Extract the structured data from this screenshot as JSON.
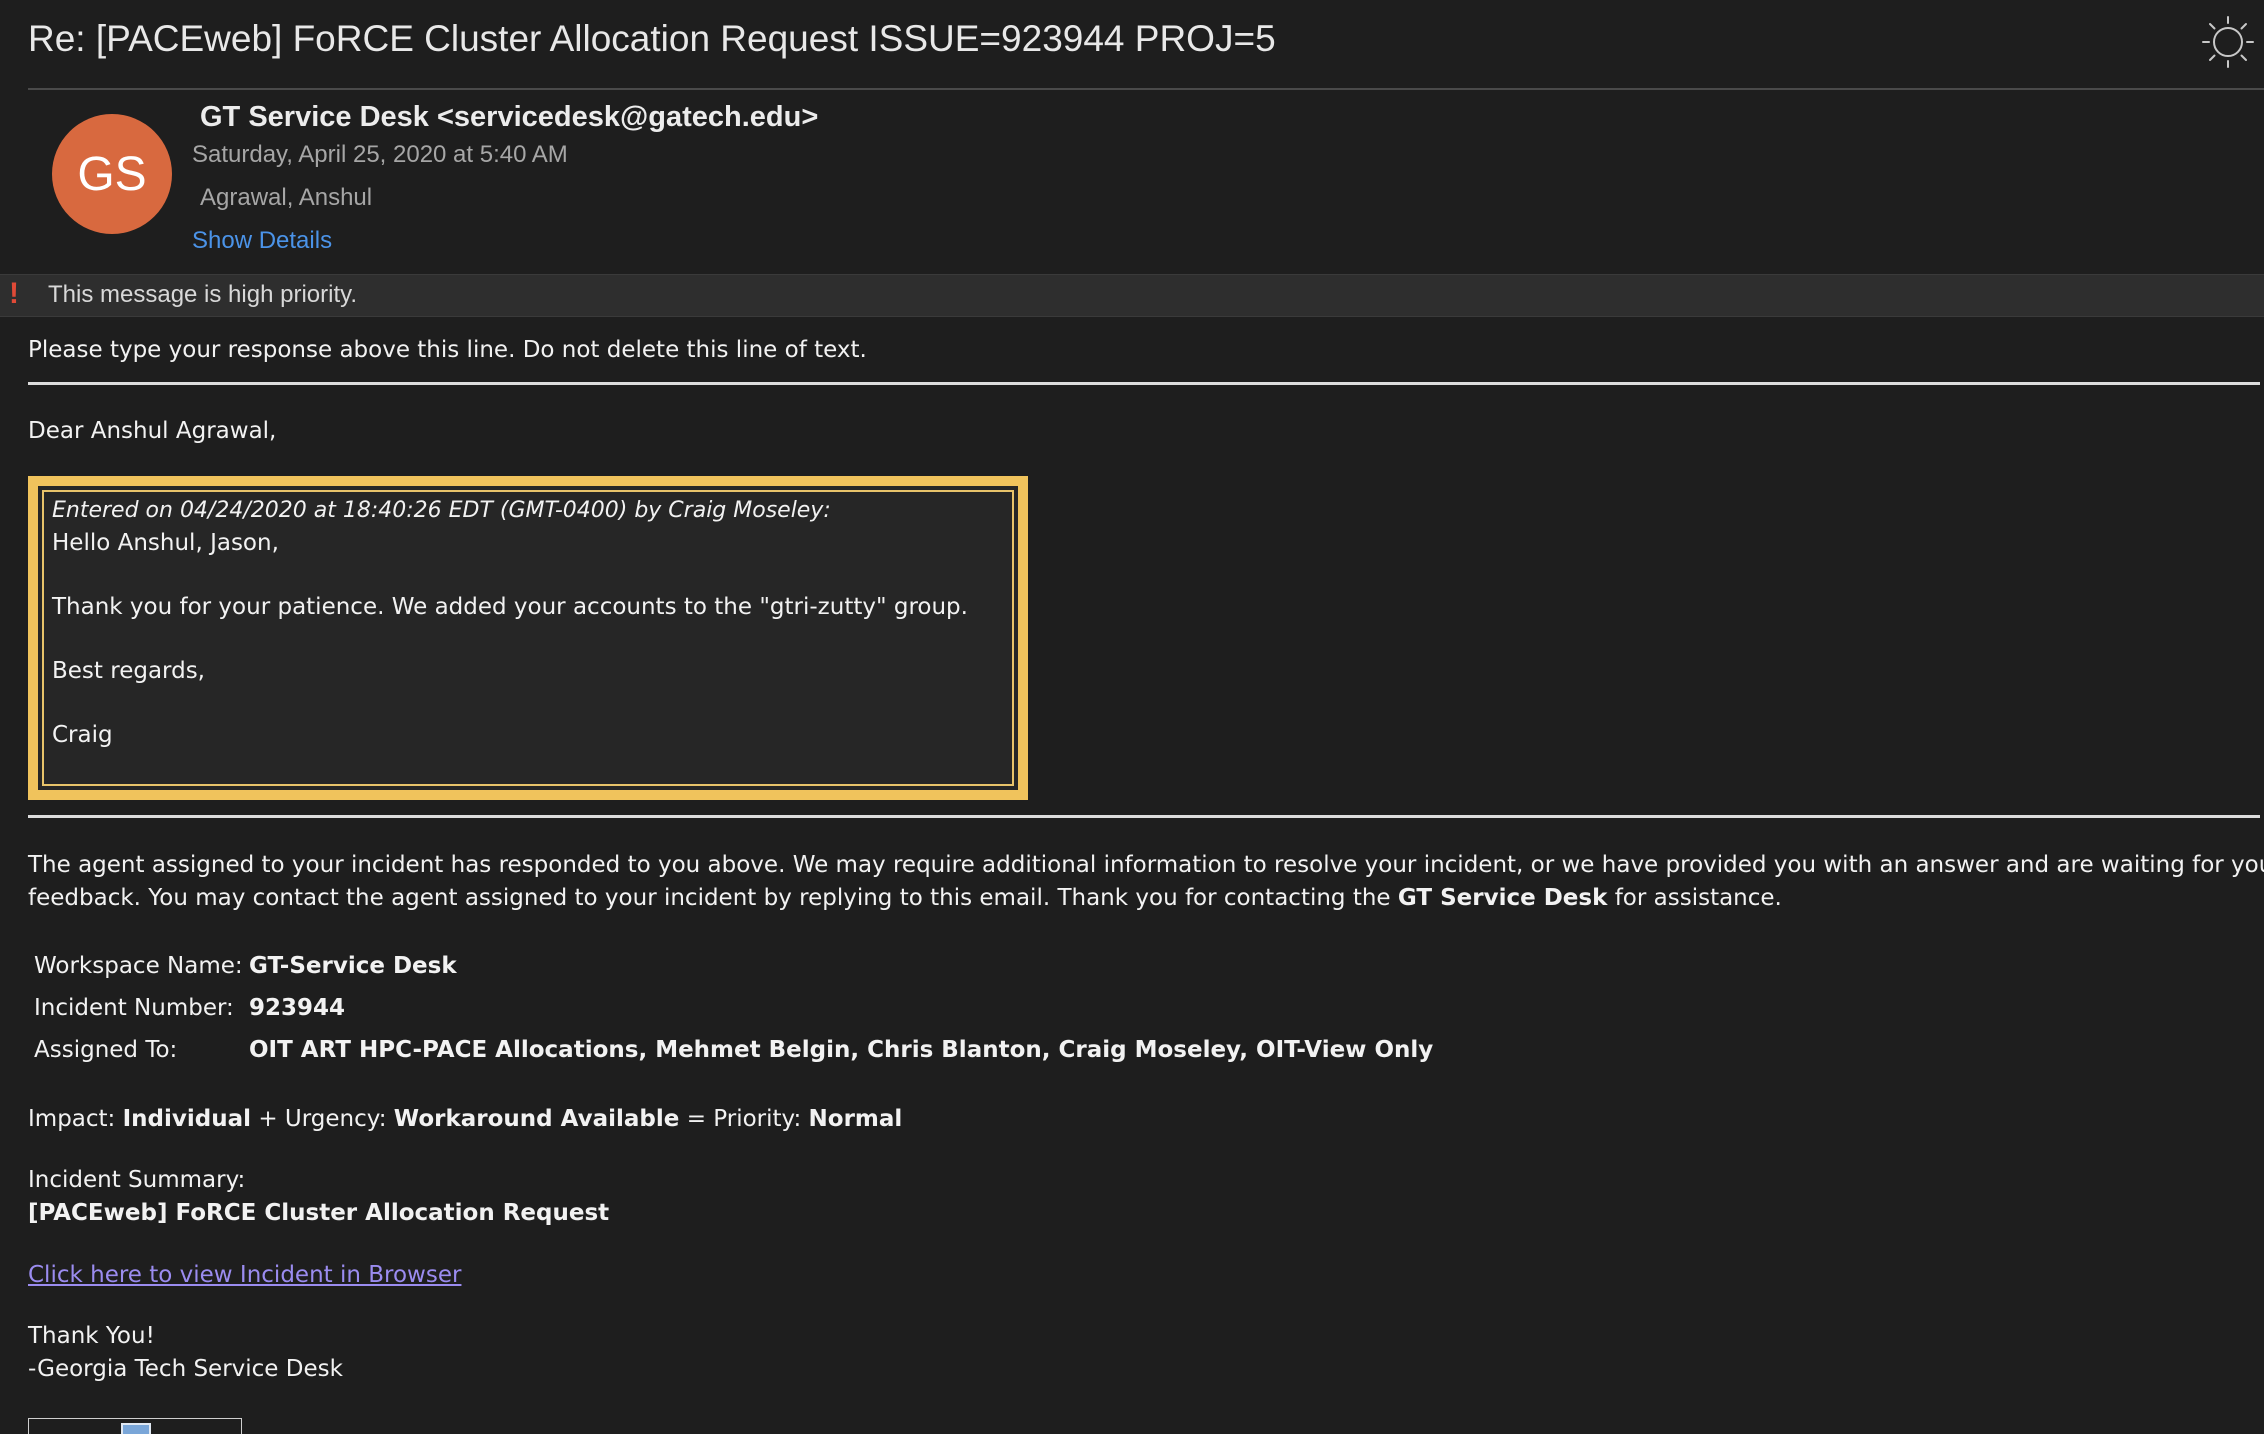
{
  "header": {
    "subject": "Re: [PACEweb] FoRCE Cluster Allocation Request ISSUE=923944 PROJ=5",
    "theme_icon": "sun-icon"
  },
  "sender": {
    "avatar_initials": "GS",
    "avatar_color": "#d8693f",
    "from": "GT Service Desk <servicedesk@gatech.edu>",
    "date": "Saturday, April 25, 2020 at 5:40 AM",
    "to": "Agrawal, Anshul",
    "show_details": "Show Details"
  },
  "priority": {
    "icon": "exclamation-icon",
    "text": "This message is high priority."
  },
  "body": {
    "instruction": "Please type your response above this line. Do not delete this line of text.",
    "greeting": "Dear Anshul Agrawal,",
    "quote": {
      "meta": "Entered on 04/24/2020 at 18:40:26 EDT (GMT-0400) by Craig Moseley:",
      "line1": "Hello Anshul, Jason,",
      "line2": "Thank you for your patience. We added your accounts to the \"gtri-zutty\" group.",
      "line3": "Best regards,",
      "line4": "Craig"
    },
    "agent_para_1": "The agent assigned to your incident has responded to you above. We may require additional information to resolve your incident, or we have provided you with an answer and are waiting for your",
    "agent_para_2a": "feedback. You may contact the agent assigned to your incident by replying to this email. Thank you for contacting the ",
    "agent_para_2b": "GT Service Desk",
    "agent_para_2c": " for assistance.",
    "details": {
      "workspace_label": "Workspace Name:",
      "workspace_value": "GT-Service Desk",
      "incident_label": "Incident Number:",
      "incident_value": "923944",
      "assigned_label": "Assigned To:",
      "assigned_value": "OIT ART HPC-PACE Allocations, Mehmet Belgin, Chris Blanton, Craig Moseley, OIT-View Only"
    },
    "impact": {
      "impact_label": "Impact: ",
      "impact_value": "Individual",
      "urgency_label": " + Urgency: ",
      "urgency_value": "Workaround Available",
      "priority_label": " = Priority: ",
      "priority_value": "Normal"
    },
    "summary_label": "Incident Summary:",
    "summary_value": "[PACEweb] FoRCE Cluster Allocation Request",
    "view_link": "Click here to view Incident in Browser",
    "thanks": "Thank You!",
    "signature": "-Georgia Tech Service Desk"
  }
}
